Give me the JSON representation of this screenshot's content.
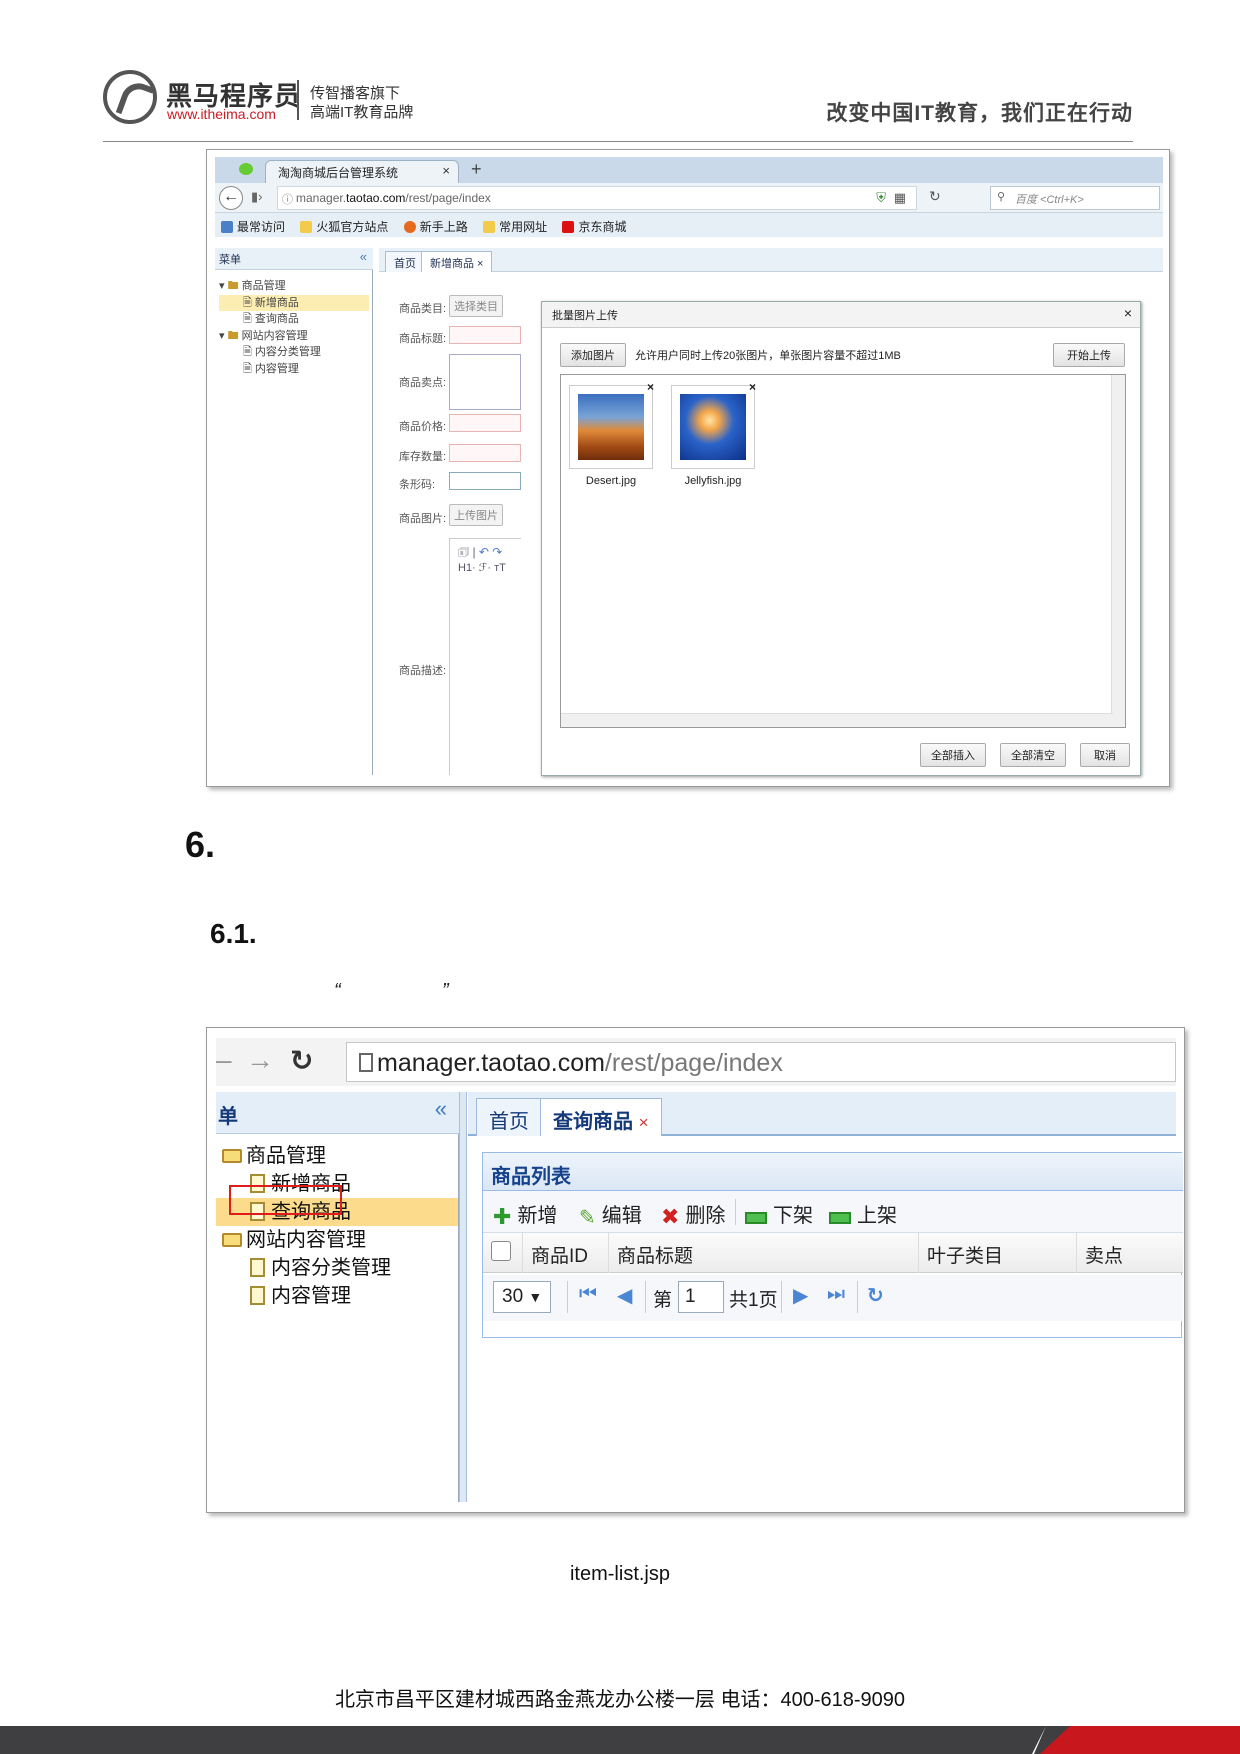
{
  "header": {
    "brand_cn": "黑马程序员",
    "brand_url": "www.itheima.com",
    "slogan_line1": "传智播客旗下",
    "slogan_line2": "高端IT教育品牌",
    "motto": "改变中国IT教育，我们正在行动"
  },
  "shot1": {
    "tab_title": "淘淘商城后台管理系统",
    "tab_close": "×",
    "tab_new": "+",
    "url_prefix": "manager.",
    "url_host": "taotao.com",
    "url_path": "/rest/page/index",
    "search_placeholder": "百度 <Ctrl+K>",
    "bookmarks": [
      "最常访问",
      "火狐官方站点",
      "新手上路",
      "常用网址",
      "京东商城"
    ],
    "sidebar_title": "菜单",
    "tree": [
      "商品管理",
      "新增商品",
      "查询商品",
      "网站内容管理",
      "内容分类管理",
      "内容管理"
    ],
    "tabs": [
      "首页",
      "新增商品 ×"
    ],
    "form_labels": [
      "商品类目:",
      "商品标题:",
      "商品卖点:",
      "商品价格:",
      "库存数量:",
      "条形码:",
      "商品图片:",
      "商品描述:"
    ],
    "select_category_btn": "选择类目",
    "upload_image_btn": "上传图片",
    "editor_row2": "H1· ℱ· ᴛT",
    "dialog": {
      "title": "批量图片上传",
      "close": "×",
      "add_button": "添加图片",
      "note": "允许用户同时上传20张图片，单张图片容量不超过1MB",
      "start_button": "开始上传",
      "files": [
        "Desert.jpg",
        "Jellyfish.jpg"
      ],
      "insert_all": "全部插入",
      "clear_all": "全部清空",
      "cancel": "取消"
    }
  },
  "headings": {
    "h6": "6.",
    "h61": "6.1.",
    "quote_open": "“",
    "quote_close": "”"
  },
  "shot2": {
    "url_dark": "manager.taotao.com",
    "url_light": "/rest/page/index",
    "sidebar_title": "单",
    "sidebar_chevron": "«",
    "tree": [
      "商品管理",
      "新增商品",
      "查询商品",
      "网站内容管理",
      "内容分类管理",
      "内容管理"
    ],
    "tabs": [
      "首页",
      "查询商品"
    ],
    "tab_close": "×",
    "panel_title": "商品列表",
    "toolbar": [
      "新增",
      "编辑",
      "删除",
      "下架",
      "上架"
    ],
    "columns": [
      "商品ID",
      "商品标题",
      "叶子类目",
      "卖点"
    ],
    "pager": {
      "page_size": "30",
      "page_prefix": "第",
      "page_value": "1",
      "page_total": "共1页"
    }
  },
  "caption": "item-list.jsp",
  "footer": "北京市昌平区建材城西路金燕龙办公楼一层   电话：400-618-9090"
}
